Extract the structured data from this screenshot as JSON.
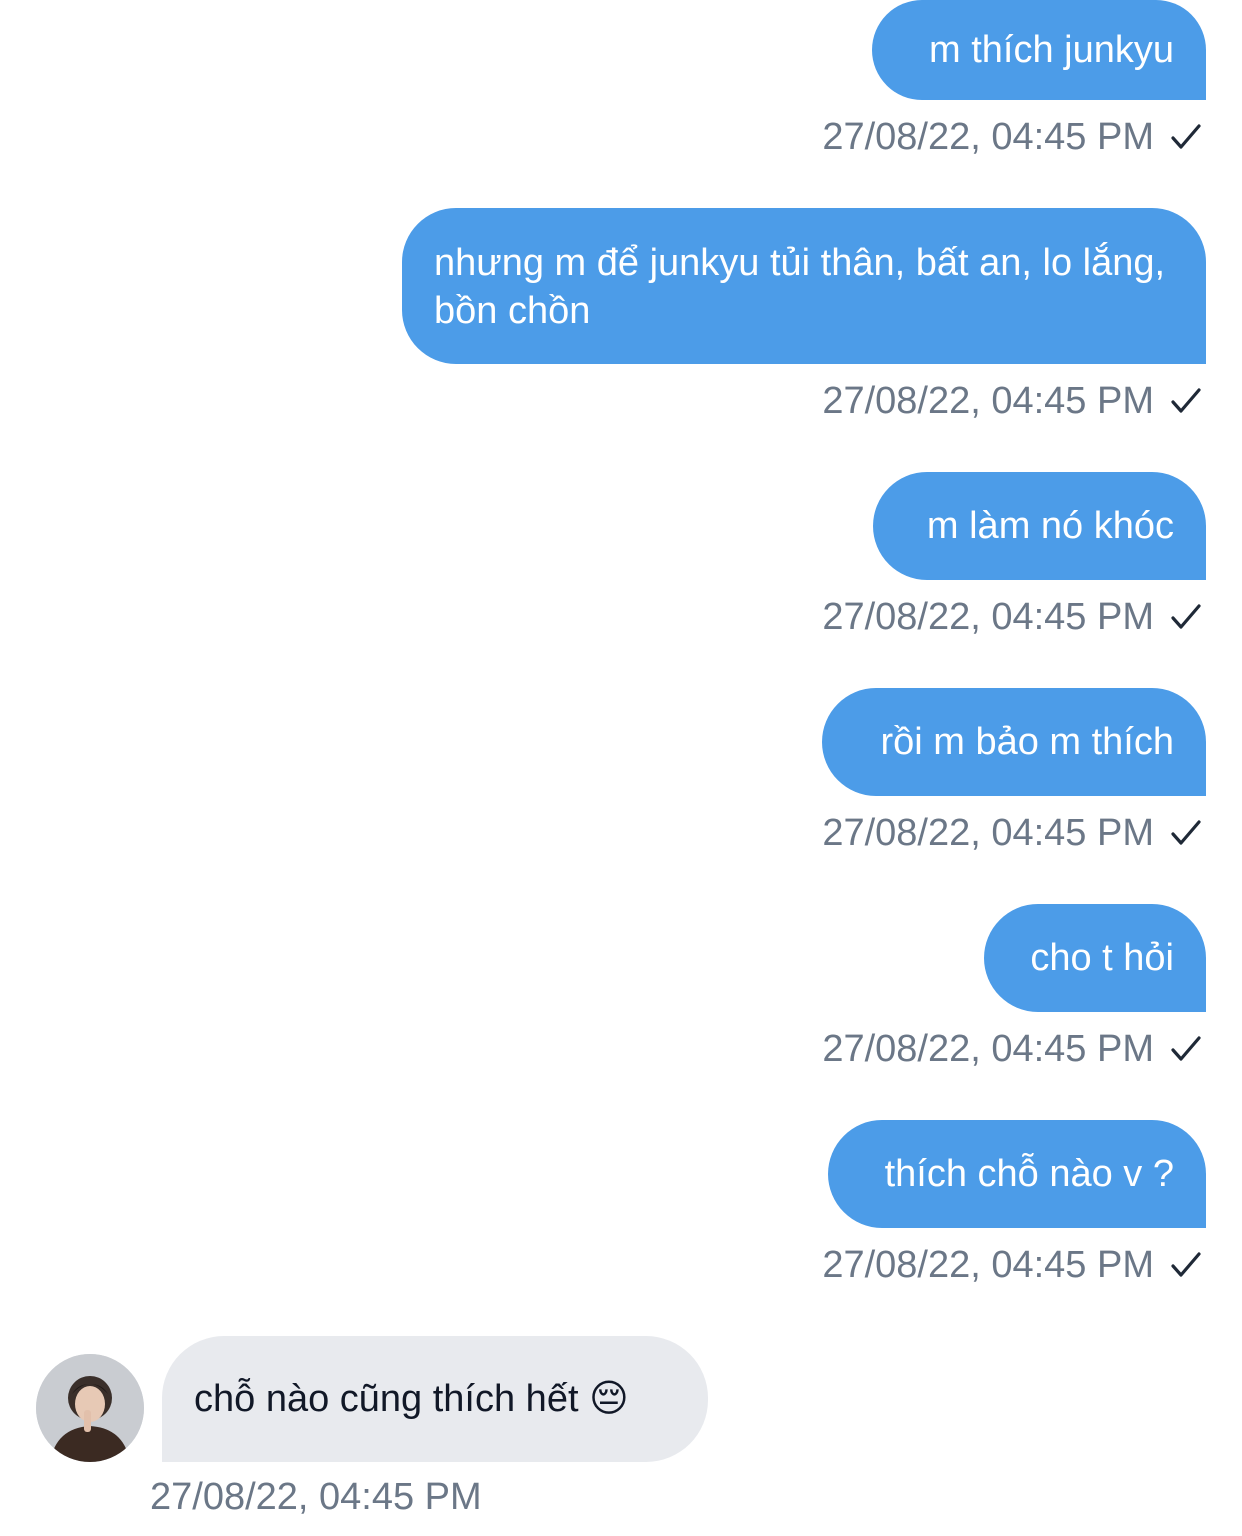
{
  "messages": [
    {
      "text": "m thích junkyu",
      "time": "27/08/22, 04:45 PM"
    },
    {
      "text": "nhưng m để junkyu tủi thân, bất an, lo lắng, bồn chồn",
      "time": "27/08/22, 04:45 PM"
    },
    {
      "text": "m làm nó khóc",
      "time": "27/08/22, 04:45 PM"
    },
    {
      "text": "rồi m bảo m thích",
      "time": "27/08/22, 04:45 PM"
    },
    {
      "text": "cho t hỏi",
      "time": "27/08/22, 04:45 PM"
    },
    {
      "text": "thích chỗ nào v ?",
      "time": "27/08/22, 04:45 PM"
    }
  ],
  "reply": {
    "text": "chỗ nào cũng thích hết 😔",
    "time": "27/08/22, 04:45 PM",
    "avatar_icon": "user-avatar"
  },
  "colors": {
    "outgoing_bubble": "#4c9ce8",
    "incoming_bubble": "#e8eaee",
    "timestamp": "#6b7787"
  },
  "icons": {
    "sent_status": "check-icon"
  }
}
